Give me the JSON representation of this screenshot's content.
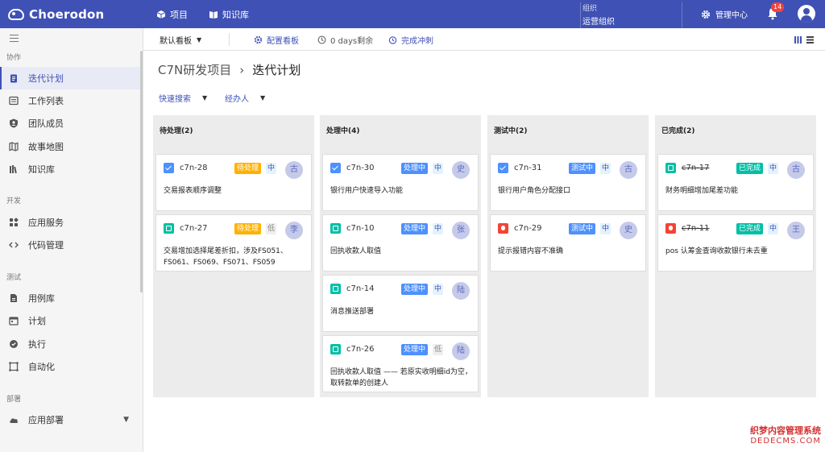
{
  "topbar": {
    "brand": "Choerodon",
    "nav": [
      {
        "label": "项目",
        "icon": "cube-icon"
      },
      {
        "label": "知识库",
        "icon": "book-icon"
      }
    ],
    "org_label": "组织",
    "org_name": "运营组织",
    "management": "管理中心",
    "notification_count": "14"
  },
  "sidebar": {
    "groups": [
      {
        "label": "协作"
      },
      {
        "label": "开发"
      },
      {
        "label": "测试"
      },
      {
        "label": "部署"
      }
    ],
    "items": [
      {
        "label": "迭代计划",
        "icon": "clipboard-icon",
        "active": true
      },
      {
        "label": "工作列表",
        "icon": "list-icon"
      },
      {
        "label": "团队成员",
        "icon": "shield-user-icon"
      },
      {
        "label": "故事地图",
        "icon": "map-icon"
      },
      {
        "label": "知识库",
        "icon": "library-icon"
      },
      {
        "label": "应用服务",
        "icon": "apps-icon"
      },
      {
        "label": "代码管理",
        "icon": "code-icon"
      },
      {
        "label": "用例库",
        "icon": "document-icon"
      },
      {
        "label": "计划",
        "icon": "calendar-icon"
      },
      {
        "label": "执行",
        "icon": "play-check-icon"
      },
      {
        "label": "自动化",
        "icon": "automation-icon"
      },
      {
        "label": "应用部署",
        "icon": "cloud-icon"
      }
    ]
  },
  "toolbar": {
    "board": "默认看板",
    "config": "配置看板",
    "remaining": "0 days剩余",
    "complete": "完成冲刺"
  },
  "breadcrumb": {
    "project": "C7N研发项目",
    "separator": "›",
    "page": "迭代计划"
  },
  "filters": {
    "quick_search": "快速搜索",
    "assignee": "经办人"
  },
  "columns": [
    {
      "title": "待处理(2)",
      "cards": [
        {
          "key": "c7n-28",
          "type": "task",
          "status": "待处理",
          "status_color": "#ffb100",
          "priority": "中",
          "avatar": "古",
          "title": "交易报表顺序调整"
        },
        {
          "key": "c7n-27",
          "type": "story",
          "status": "待处理",
          "status_color": "#ffb100",
          "priority": "低",
          "avatar": "李",
          "title": "交易增加选择尾差折扣，涉及FS051、FS061、FS069、FS071、FS059"
        }
      ]
    },
    {
      "title": "处理中(4)",
      "cards": [
        {
          "key": "c7n-30",
          "type": "task",
          "status": "处理中",
          "status_color": "#4d90fe",
          "priority": "中",
          "avatar": "史",
          "title": "银行用户快速导入功能"
        },
        {
          "key": "c7n-10",
          "type": "story",
          "status": "处理中",
          "status_color": "#4d90fe",
          "priority": "中",
          "avatar": "张",
          "title": "回执收款人取值"
        },
        {
          "key": "c7n-14",
          "type": "story",
          "status": "处理中",
          "status_color": "#4d90fe",
          "priority": "中",
          "avatar": "陆",
          "title": "消息推送部署"
        },
        {
          "key": "c7n-26",
          "type": "story",
          "status": "处理中",
          "status_color": "#4d90fe",
          "priority": "低",
          "avatar": "陆",
          "title": "回执收款人取值 —— 若原实收明细id为空，取转款单的创建人"
        }
      ]
    },
    {
      "title": "测试中(2)",
      "cards": [
        {
          "key": "c7n-31",
          "type": "task",
          "status": "测试中",
          "status_color": "#4d90fe",
          "priority": "中",
          "avatar": "古",
          "title": "银行用户角色分配接口"
        },
        {
          "key": "c7n-29",
          "type": "bug",
          "status": "测试中",
          "status_color": "#4d90fe",
          "priority": "中",
          "avatar": "史",
          "title": "提示报错内容不准确"
        }
      ]
    },
    {
      "title": "已完成(2)",
      "cards": [
        {
          "key": "c7n-17",
          "type": "story",
          "status": "已完成",
          "status_color": "#00bfa5",
          "priority": "中",
          "avatar": "古",
          "title": "财务明细增加尾差功能",
          "done": true
        },
        {
          "key": "c7n-11",
          "type": "bug",
          "status": "已完成",
          "status_color": "#00bfa5",
          "priority": "中",
          "avatar": "王",
          "title": "pos 认筹金查询收款银行未去重",
          "done": true
        }
      ]
    }
  ],
  "watermark": {
    "line1": "织梦内容管理系统",
    "line2": "DEDECMS.COM"
  }
}
